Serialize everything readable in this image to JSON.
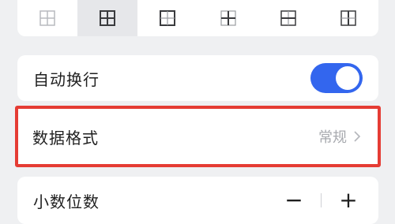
{
  "border_options": [
    {
      "icon": "border-grid-light-icon",
      "active": false
    },
    {
      "icon": "border-all-icon",
      "active": true
    },
    {
      "icon": "border-outside-icon",
      "active": false
    },
    {
      "icon": "border-inside-icon",
      "active": false
    },
    {
      "icon": "border-horizontal-icon",
      "active": false
    },
    {
      "icon": "border-vertical-icon",
      "active": false
    }
  ],
  "wrap_text": {
    "label": "自动换行",
    "enabled": true
  },
  "number_format": {
    "label": "数据格式",
    "value": "常规"
  },
  "decimal_places": {
    "label": "小数位数",
    "minus": "−",
    "plus": "+"
  },
  "colors": {
    "accent": "#3366ee",
    "highlight": "#e53c34"
  }
}
